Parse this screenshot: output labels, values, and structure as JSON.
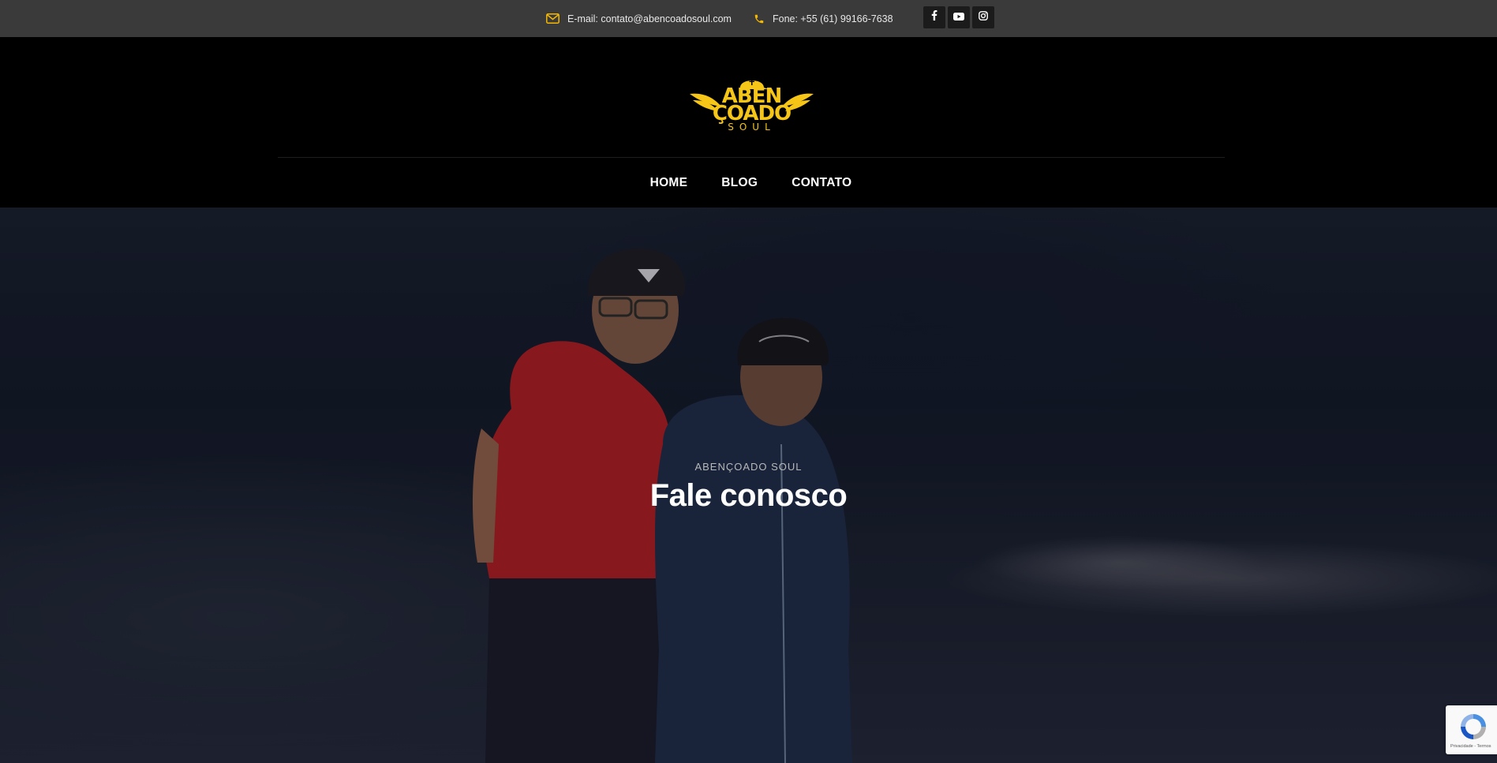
{
  "topbar": {
    "email_text": "E-mail: contato@abencoadosoul.com",
    "email_icon": "envelope-icon",
    "phone_text": "Fone: +55 (61) 99166-7638",
    "phone_icon": "phone-icon",
    "socials": [
      {
        "name": "facebook",
        "icon": "facebook-icon"
      },
      {
        "name": "youtube",
        "icon": "youtube-icon"
      },
      {
        "name": "instagram",
        "icon": "instagram-icon"
      }
    ],
    "accent_color": "#f5b800"
  },
  "logo": {
    "line1": "ABEN",
    "line2": "ÇOADO",
    "line3": "SOUL",
    "color": "#f5c518"
  },
  "nav": {
    "items": [
      {
        "label": "HOME"
      },
      {
        "label": "BLOG"
      },
      {
        "label": "CONTATO"
      }
    ]
  },
  "hero": {
    "kicker": "ABENÇOADO SOUL",
    "title": "Fale conosco"
  },
  "recaptcha": {
    "text": "Privacidade - Termos"
  }
}
